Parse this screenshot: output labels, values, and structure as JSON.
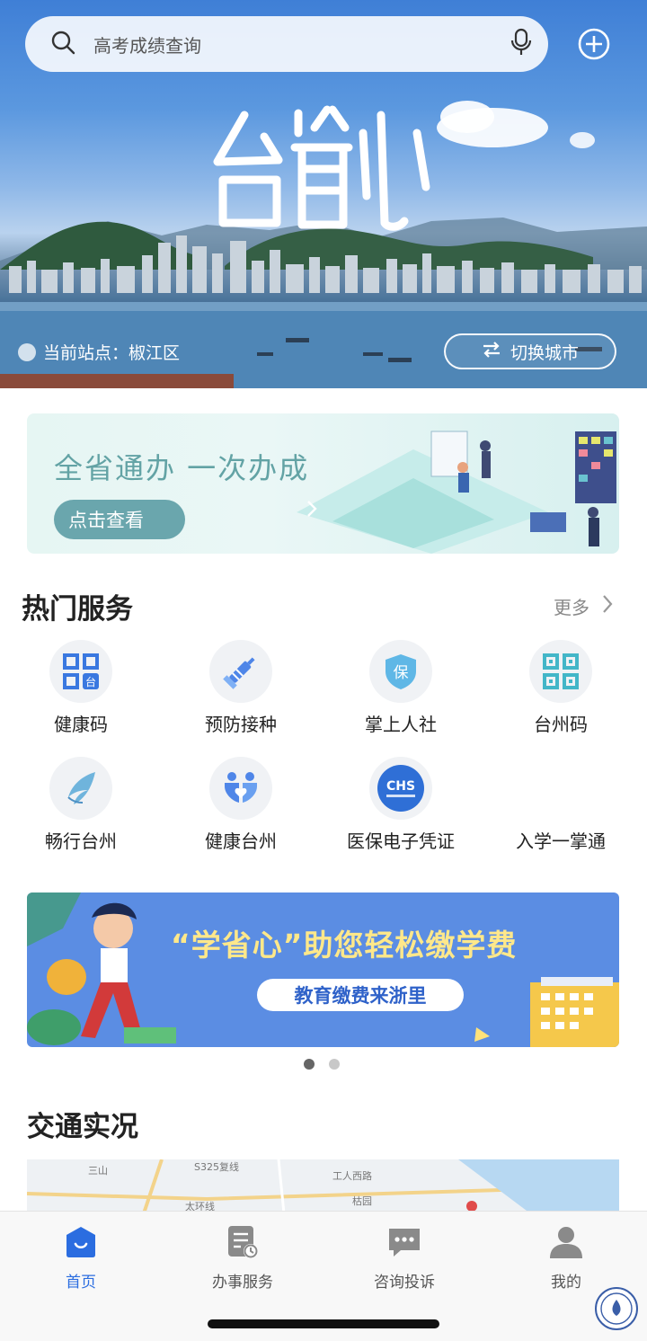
{
  "search": {
    "placeholder": "高考成绩查询",
    "icon": "search-icon",
    "mic_icon": "microphone-icon"
  },
  "header": {
    "add_icon": "plus-circle-icon",
    "brand_logo": "台省心"
  },
  "location": {
    "label": "当前站点：椒江区",
    "switch_label": "切换城市",
    "switch_icon": "swap-arrows-icon"
  },
  "promo_banner": {
    "title": "全省通办 一次办成",
    "cta_label": "点击查看"
  },
  "hot_services": {
    "title": "热门服务",
    "more_label": "更多",
    "items": [
      {
        "label": "健康码",
        "icon": "qr-health-icon"
      },
      {
        "label": "预防接种",
        "icon": "syringe-icon"
      },
      {
        "label": "掌上人社",
        "icon": "shield-bao-icon"
      },
      {
        "label": "台州码",
        "icon": "qr-code-icon"
      },
      {
        "label": "畅行台州",
        "icon": "bird-wing-icon"
      },
      {
        "label": "健康台州",
        "icon": "family-heart-icon"
      },
      {
        "label": "医保电子凭证",
        "icon": "chs-badge-icon"
      },
      {
        "label": "入学一掌通",
        "icon": "school-icon"
      }
    ]
  },
  "edu_banner": {
    "headline": "“学省心”助您轻松缴学费",
    "pill": "教育缴费来浙里"
  },
  "carousel": {
    "count": 2,
    "active": 0
  },
  "traffic": {
    "title": "交通实况",
    "map_labels": [
      "三山",
      "S325复线",
      "工人西路",
      "枯园",
      "太环线"
    ]
  },
  "tabbar": {
    "items": [
      {
        "label": "首页",
        "icon": "home-icon",
        "active": true
      },
      {
        "label": "办事服务",
        "icon": "document-clock-icon",
        "active": false
      },
      {
        "label": "咨询投诉",
        "icon": "chat-bubble-icon",
        "active": false
      },
      {
        "label": "我的",
        "icon": "user-icon",
        "active": false
      }
    ]
  },
  "colors": {
    "accent": "#2b6de0",
    "promo_text": "#63a3a5",
    "edu_bg": "#5b8de3"
  }
}
